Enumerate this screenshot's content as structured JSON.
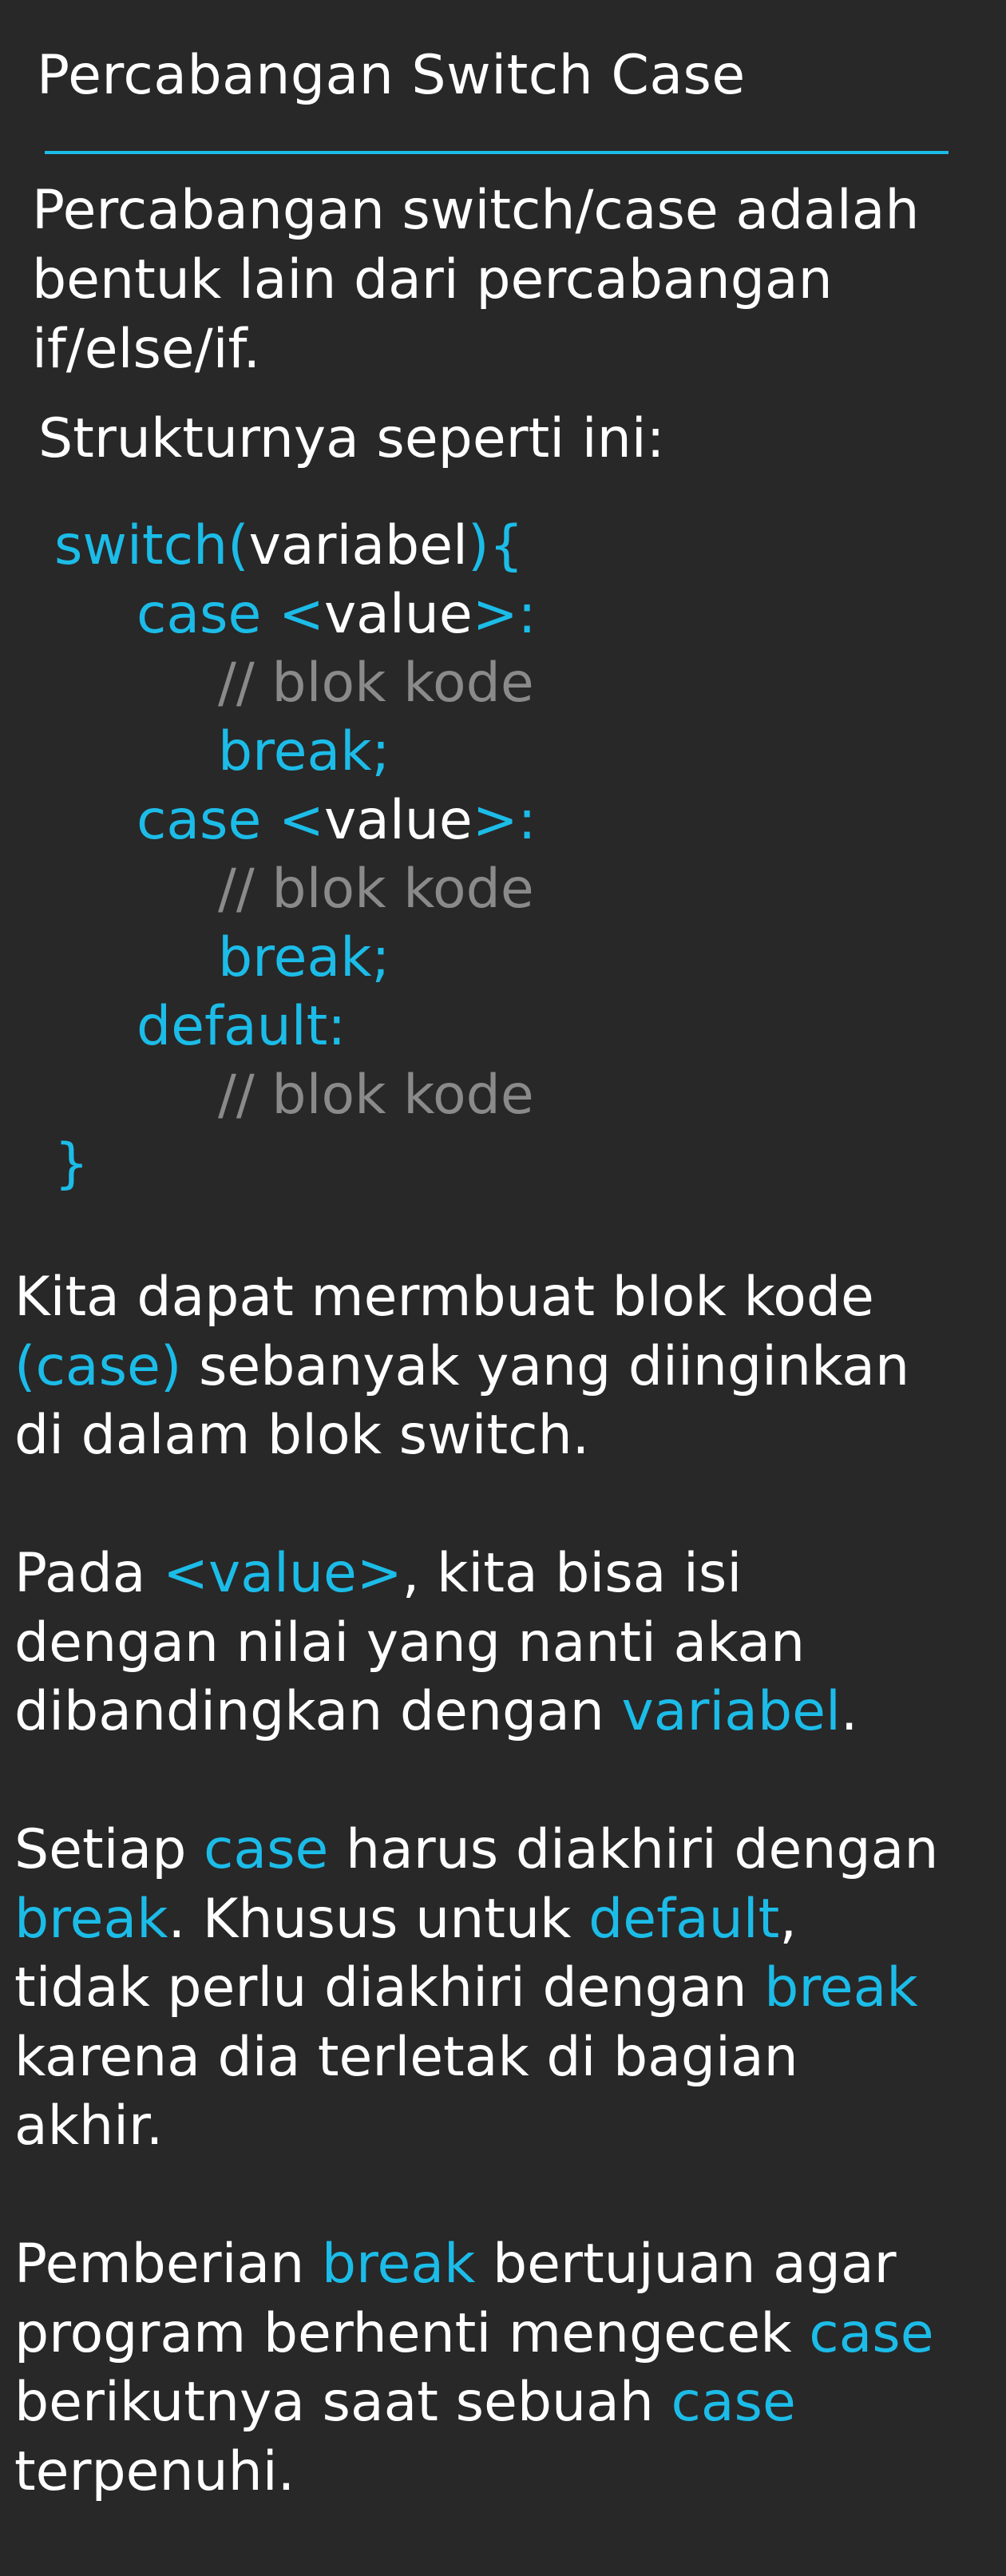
{
  "title": "Percabangan Switch Case",
  "colors": {
    "background": "#282828",
    "accent": "#1cbce8",
    "text": "#ffffff",
    "comment": "#8a8a8a"
  },
  "intro": {
    "line1": "Percabangan switch/case adalah",
    "line2": "bentuk lain dari percabangan",
    "line3": "if/else/if."
  },
  "struktur": "Strukturnya seperti ini:",
  "code": {
    "switch_kw": "switch(",
    "switch_var": "variabel",
    "switch_close": "){",
    "case_kw": "case",
    "lt": "<",
    "value": "value",
    "gt_colon": ">:",
    "comment": "// blok kode",
    "break_kw": "break;",
    "default_kw": "default:",
    "close_brace": "}"
  },
  "paragraphs": {
    "p1": {
      "l1": "Kita dapat mermbuat blok kode",
      "case_hl": "(case)",
      "l2_rest": " sebanyak yang diinginkan",
      "l3": "di dalam blok switch."
    },
    "p2": {
      "pre": "Pada ",
      "value_hl": "<value>",
      "l1_rest": ", kita bisa isi",
      "l2": "dengan nilai yang nanti akan",
      "l3_pre": "dibandingkan dengan ",
      "variabel_hl": "variabel",
      "l3_post": "."
    },
    "p3": {
      "pre": "Setiap ",
      "case_hl": "case",
      "l1_rest": " harus diakhiri dengan",
      "break_hl": "break",
      "l2_mid": ". Khusus untuk ",
      "default_hl": "default",
      "l2_post": ",",
      "l3_pre": "tidak perlu diakhiri dengan ",
      "break_hl2": "break",
      "l4": "karena dia terletak di bagian",
      "l5": "akhir."
    },
    "p4": {
      "pre": "Pemberian ",
      "break_hl": "break",
      "l1_rest": " bertujuan agar",
      "l2_pre": "program berhenti mengecek ",
      "case_hl": "case",
      "l3_pre": "berikutnya saat sebuah ",
      "case_hl2": "case",
      "l4": "terpenuhi."
    }
  }
}
